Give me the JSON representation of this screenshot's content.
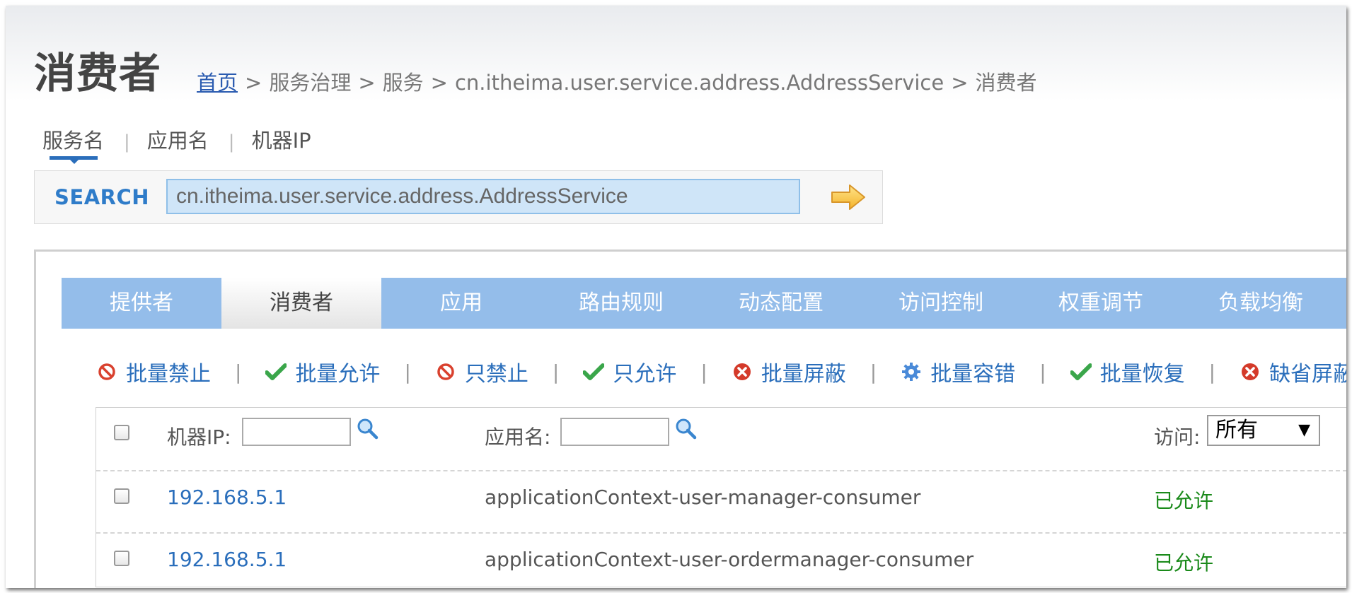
{
  "page": {
    "title": "消费者"
  },
  "breadcrumb": {
    "home": "首页",
    "sep": ">",
    "items": [
      "服务治理",
      "服务",
      "cn.itheima.user.service.address.AddressService",
      "消费者"
    ]
  },
  "search": {
    "tabs": [
      "服务名",
      "应用名",
      "机器IP"
    ],
    "active_tab": "服务名",
    "label": "SEARCH",
    "value": "cn.itheima.user.service.address.AddressService",
    "go_icon": "arrow-right-icon"
  },
  "tabs": [
    "提供者",
    "消费者",
    "应用",
    "路由规则",
    "动态配置",
    "访问控制",
    "权重调节",
    "负载均衡"
  ],
  "active_tab": "消费者",
  "actions": [
    {
      "label": "批量禁止",
      "icon": "forbid-icon"
    },
    {
      "label": "批量允许",
      "icon": "check-icon"
    },
    {
      "label": "只禁止",
      "icon": "forbid-icon"
    },
    {
      "label": "只允许",
      "icon": "check-icon"
    },
    {
      "label": "批量屏蔽",
      "icon": "x-circle-icon"
    },
    {
      "label": "批量容错",
      "icon": "gear-icon"
    },
    {
      "label": "批量恢复",
      "icon": "check-icon"
    },
    {
      "label": "缺省屏蔽",
      "icon": "x-circle-icon"
    }
  ],
  "table": {
    "filter": {
      "ip_label": "机器IP:",
      "app_label": "应用名:",
      "access_label": "访问:",
      "access_value": "所有"
    },
    "rows": [
      {
        "ip": "192.168.5.1",
        "app": "applicationContext-user-manager-consumer",
        "access": "已允许"
      },
      {
        "ip": "192.168.5.1",
        "app": "applicationContext-user-ordermanager-consumer",
        "access": "已允许"
      }
    ]
  },
  "colors": {
    "tab_bg": "#94bdea",
    "link": "#2a6ebb",
    "allowed": "#1a8a1a",
    "forbid": "#d9412e"
  }
}
